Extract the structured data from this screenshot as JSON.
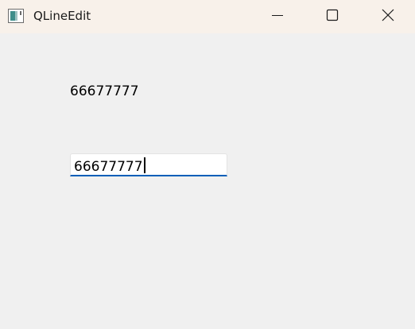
{
  "window": {
    "title": "QLineEdit",
    "icon": "qt-app-icon",
    "controls": {
      "minimize": "minimize-icon",
      "maximize": "maximize-icon",
      "close": "close-icon"
    }
  },
  "content": {
    "label_text": "66677777",
    "line_edit": {
      "value": "66677777",
      "focused": true
    }
  },
  "colors": {
    "titlebar": "#f8f1ea",
    "background": "#f0f0f0",
    "focus_accent": "#005fb8"
  }
}
